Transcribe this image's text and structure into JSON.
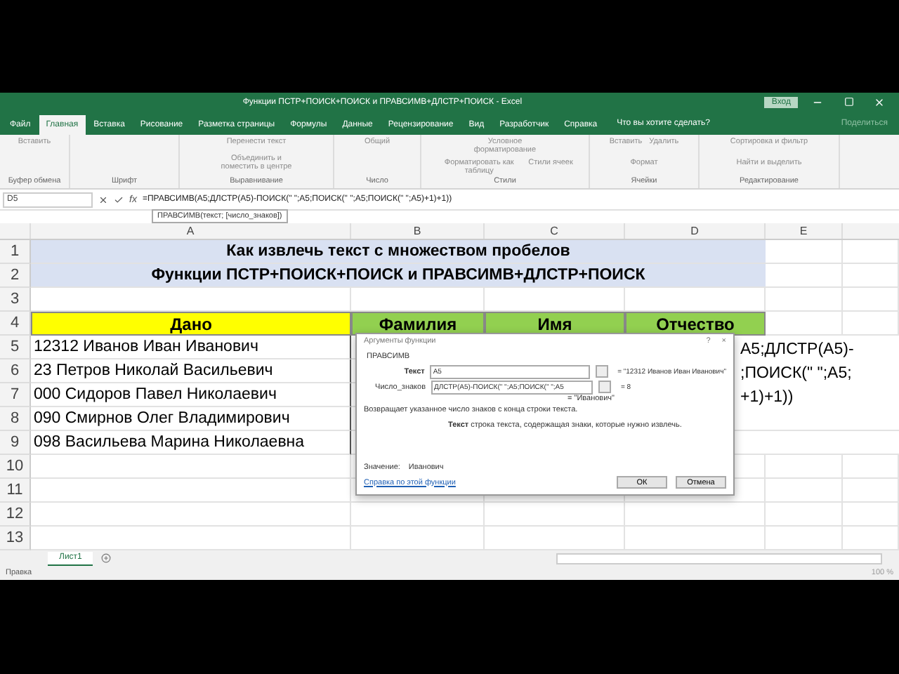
{
  "window": {
    "title": "Функции ПСТР+ПОИСК+ПОИСК и ПРАВСИМВ+ДЛСТР+ПОИСК - Excel",
    "sign_in": "Вход"
  },
  "tabs": [
    {
      "label": "Файл",
      "selected": false
    },
    {
      "label": "Главная",
      "selected": true
    },
    {
      "label": "Вставка",
      "selected": false
    },
    {
      "label": "Рисование",
      "selected": false
    },
    {
      "label": "Разметка страницы",
      "selected": false
    },
    {
      "label": "Формулы",
      "selected": false
    },
    {
      "label": "Данные",
      "selected": false
    },
    {
      "label": "Рецензирование",
      "selected": false
    },
    {
      "label": "Вид",
      "selected": false
    },
    {
      "label": "Разработчик",
      "selected": false
    },
    {
      "label": "Справка",
      "selected": false
    }
  ],
  "tell_me": "Что вы хотите сделать?",
  "share": "Поделиться",
  "ribbon": [
    {
      "name": "Буфер обмена",
      "buttons": [
        "Вставить"
      ]
    },
    {
      "name": "Шрифт"
    },
    {
      "name": "Выравнивание",
      "buttons": [
        "Перенести текст",
        "Объединить и поместить в центре"
      ]
    },
    {
      "name": "Число",
      "buttons": [
        "Общий"
      ]
    },
    {
      "name": "Стили",
      "buttons": [
        "Условное форматирование",
        "Форматировать как таблицу",
        "Стили ячеек"
      ]
    },
    {
      "name": "Ячейки",
      "buttons": [
        "Вставить",
        "Удалить",
        "Формат"
      ]
    },
    {
      "name": "Редактирование",
      "buttons": [
        "Сортировка и фильтр",
        "Найти и выделить"
      ]
    }
  ],
  "formula_bar": {
    "name_box": "D5",
    "fx": "fx",
    "formula": "=ПРАВСИМВ(A5;ДЛСТР(A5)-ПОИСК(\" \";A5;ПОИСК(\" \";A5;ПОИСК(\" \";A5)+1)+1))",
    "tooltip": "ПРАВСИМВ(текст; [число_знаков])"
  },
  "columns": [
    "A",
    "B",
    "C",
    "D",
    "E"
  ],
  "row_numbers": [
    "1",
    "2",
    "3",
    "4",
    "5",
    "6",
    "7",
    "8",
    "9",
    "10",
    "11",
    "12",
    "13"
  ],
  "sheet": {
    "title": "Как извлечь текст с множеством пробелов",
    "subtitle": "Функции ПСТР+ПОИСК+ПОИСК и ПРАВСИМВ+ДЛСТР+ПОИСК",
    "headers": [
      {
        "label": "Дано",
        "color": "#ffff00"
      },
      {
        "label": "Фамилия",
        "color": "#92d050"
      },
      {
        "label": "Имя",
        "color": "#92d050"
      },
      {
        "label": "Отчество",
        "color": "#92d050"
      }
    ],
    "rows": [
      "12312 Иванов Иван Иванович",
      "23 Петров Николай Васильевич",
      "000 Сидоров Павел Николаевич",
      "090 Смирнов Олег Владимирович",
      "098 Васильева Марина Николаевна"
    ],
    "spill": [
      "A5;ДЛСТР(A5)-",
      ";ПОИСК(\" \";A5;",
      "+1)+1))"
    ]
  },
  "dialog": {
    "title": "Аргументы функции",
    "help": "?",
    "close": "×",
    "function": "ПРАВСИМВ",
    "args": [
      {
        "label": "Текст",
        "value": "A5",
        "result": "= \"12312 Иванов Иван Иванович\""
      },
      {
        "label": "Число_знаков",
        "value": "ДЛСТР(A5)-ПОИСК(\" \";A5;ПОИСК(\" \";A5",
        "result": "= 8"
      }
    ],
    "total": "= \"Иванович\"",
    "description": "Возвращает указанное число знаков с конца строки текста.",
    "arg_name": "Текст",
    "arg_help": "строка текста, содержащая знаки, которые нужно извлечь.",
    "value_label": "Значение:",
    "value": "Иванович",
    "link": "Справка по этой функции",
    "buttons": [
      "ОК",
      "Отмена"
    ]
  },
  "sheet_tabs": [
    {
      "label": "Лист1",
      "selected": true
    }
  ],
  "status": {
    "mode": "Правка",
    "zoom": "100 %"
  }
}
